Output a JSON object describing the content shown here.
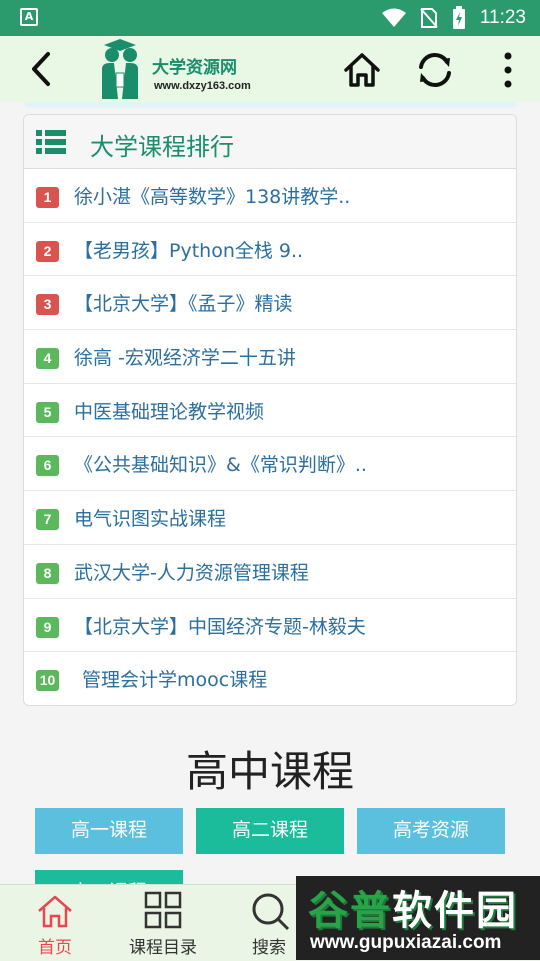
{
  "status_bar": {
    "time": "11:23",
    "left_icon": "A"
  },
  "header": {
    "logo_title": "大学资源网",
    "logo_url": "www.dxzy163.com"
  },
  "ranking": {
    "title": "大学课程排行",
    "items": [
      {
        "rank": "1",
        "title": "徐小湛《高等数学》138讲教学..",
        "badge_color": "#d9534f"
      },
      {
        "rank": "2",
        "title": "【老男孩】Python全栈 9..",
        "badge_color": "#d9534f"
      },
      {
        "rank": "3",
        "title": "【北京大学】《孟子》精读",
        "badge_color": "#d9534f"
      },
      {
        "rank": "4",
        "title": "徐高 -宏观经济学二十五讲",
        "badge_color": "#5cb85c"
      },
      {
        "rank": "5",
        "title": "中医基础理论教学视频",
        "badge_color": "#5cb85c"
      },
      {
        "rank": "6",
        "title": "《公共基础知识》&《常识判断》..",
        "badge_color": "#5cb85c"
      },
      {
        "rank": "7",
        "title": "电气识图实战课程",
        "badge_color": "#5cb85c"
      },
      {
        "rank": "8",
        "title": "武汉大学-人力资源管理课程",
        "badge_color": "#5cb85c"
      },
      {
        "rank": "9",
        "title": "【北京大学】中国经济专题-林毅夫",
        "badge_color": "#5cb85c"
      },
      {
        "rank": "10",
        "title": "管理会计学mooc课程",
        "badge_color": "#5cb85c"
      }
    ]
  },
  "high_school": {
    "title": "高中课程",
    "buttons": [
      {
        "label": "高一课程",
        "color": "#5bc0de"
      },
      {
        "label": "高二课程",
        "color": "#1abc9c"
      },
      {
        "label": "高考资源",
        "color": "#5bc0de"
      },
      {
        "label": "高三课程",
        "color": "#1abc9c"
      }
    ]
  },
  "bottom_nav": {
    "tabs": [
      {
        "label": "首页",
        "active": true
      },
      {
        "label": "课程目录",
        "active": false
      },
      {
        "label": "搜索",
        "active": false
      }
    ]
  },
  "watermark": {
    "big": "谷普软件园",
    "small": "www.gupuxiazai.com"
  },
  "colors": {
    "status": "#2b9a6c",
    "header_bg": "#e9f7e5",
    "brand": "#1a8d6b",
    "link": "#2b6f9f",
    "nav_active": "#e8474f"
  }
}
